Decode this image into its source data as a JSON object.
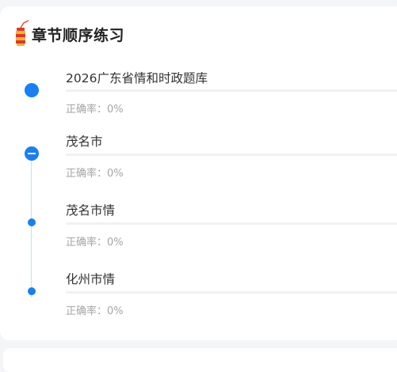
{
  "header": {
    "title": "章节顺序练习",
    "icon": "firecracker-icon"
  },
  "chapters": [
    {
      "title": "2026广东省情和时政题库",
      "accuracy_label": "正确率：",
      "accuracy_value": "0%",
      "progress": 0,
      "marker": "dot-large"
    },
    {
      "title": "茂名市",
      "accuracy_label": "正确率：",
      "accuracy_value": "0%",
      "progress": 0,
      "marker": "collapse-minus"
    },
    {
      "title": "茂名市情",
      "accuracy_label": "正确率：",
      "accuracy_value": "0%",
      "progress": 0,
      "marker": "dot-small"
    },
    {
      "title": "化州市情",
      "accuracy_label": "正确率：",
      "accuracy_value": "0%",
      "progress": 0,
      "marker": "dot-small"
    }
  ],
  "colors": {
    "accent": "#1a7ff2",
    "timeline": "#bfe3f8",
    "muted_text": "#a5a5a5"
  }
}
